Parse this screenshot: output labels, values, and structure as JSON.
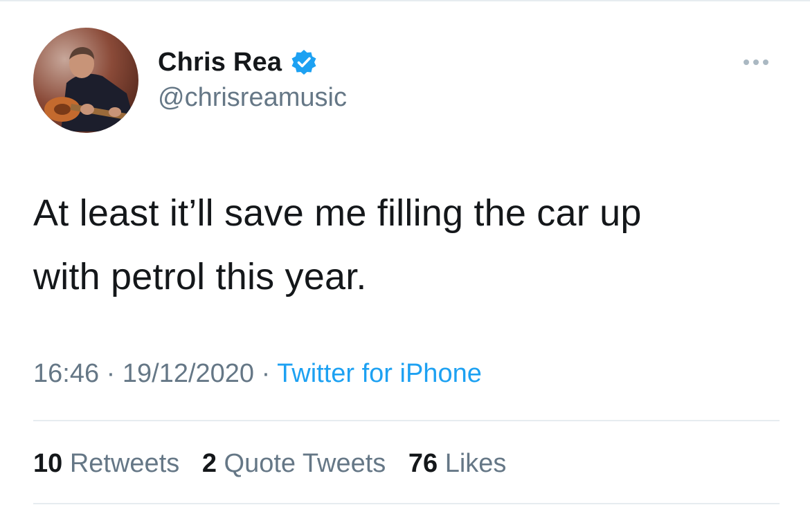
{
  "tweet": {
    "author": {
      "display_name": "Chris Rea",
      "handle": "@chrisreamusic",
      "verified": true,
      "verified_icon": "verified-badge-icon"
    },
    "text_lines": [
      "At least it’ll save me filling the car up",
      "with petrol this year."
    ],
    "time": "16:46",
    "date": "19/12/2020",
    "separator": "·",
    "source": "Twitter for iPhone",
    "stats": {
      "retweets_count": "10",
      "retweets_label": "Retweets",
      "quotes_count": "2",
      "quotes_label": "Quote Tweets",
      "likes_count": "76",
      "likes_label": "Likes"
    }
  },
  "colors": {
    "text": "#14171a",
    "secondary": "#657786",
    "accent": "#1da1f2",
    "divider": "#e6ecf0"
  },
  "icons": {
    "more": "more-horizontal-icon"
  }
}
